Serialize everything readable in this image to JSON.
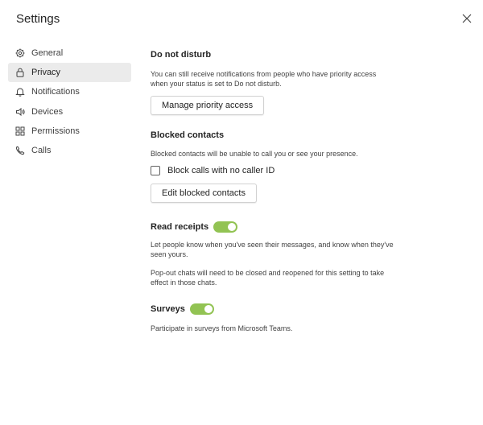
{
  "window": {
    "title": "Settings",
    "close_icon": "close-icon"
  },
  "sidebar": {
    "items": [
      {
        "label": "General",
        "icon": "gear-icon"
      },
      {
        "label": "Privacy",
        "icon": "lock-icon",
        "active": true
      },
      {
        "label": "Notifications",
        "icon": "bell-icon"
      },
      {
        "label": "Devices",
        "icon": "speaker-icon"
      },
      {
        "label": "Permissions",
        "icon": "grid-icon"
      },
      {
        "label": "Calls",
        "icon": "phone-icon"
      }
    ]
  },
  "dnd": {
    "title": "Do not disturb",
    "desc_line1": "You can still receive notifications from people who have priority access",
    "desc_line2": "when your status is set to Do not disturb.",
    "button": "Manage priority access"
  },
  "blocked": {
    "title": "Blocked contacts",
    "desc": "Blocked contacts will be unable to call you or see your presence.",
    "checkbox_label": "Block calls with no caller ID",
    "checkbox_checked": false,
    "button": "Edit blocked contacts"
  },
  "read_receipts": {
    "title": "Read receipts",
    "enabled": true,
    "desc1_line1": "Let people know when you've seen their messages, and know when they've",
    "desc1_line2": "seen yours.",
    "desc2_line1": "Pop-out chats will need to be closed and reopened for this setting to take",
    "desc2_line2": "effect in those chats."
  },
  "surveys": {
    "title": "Surveys",
    "enabled": true,
    "desc": "Participate in surveys from Microsoft Teams."
  },
  "colors": {
    "toggle_on": "#92c353",
    "active_nav_bg": "#ebebeb"
  }
}
